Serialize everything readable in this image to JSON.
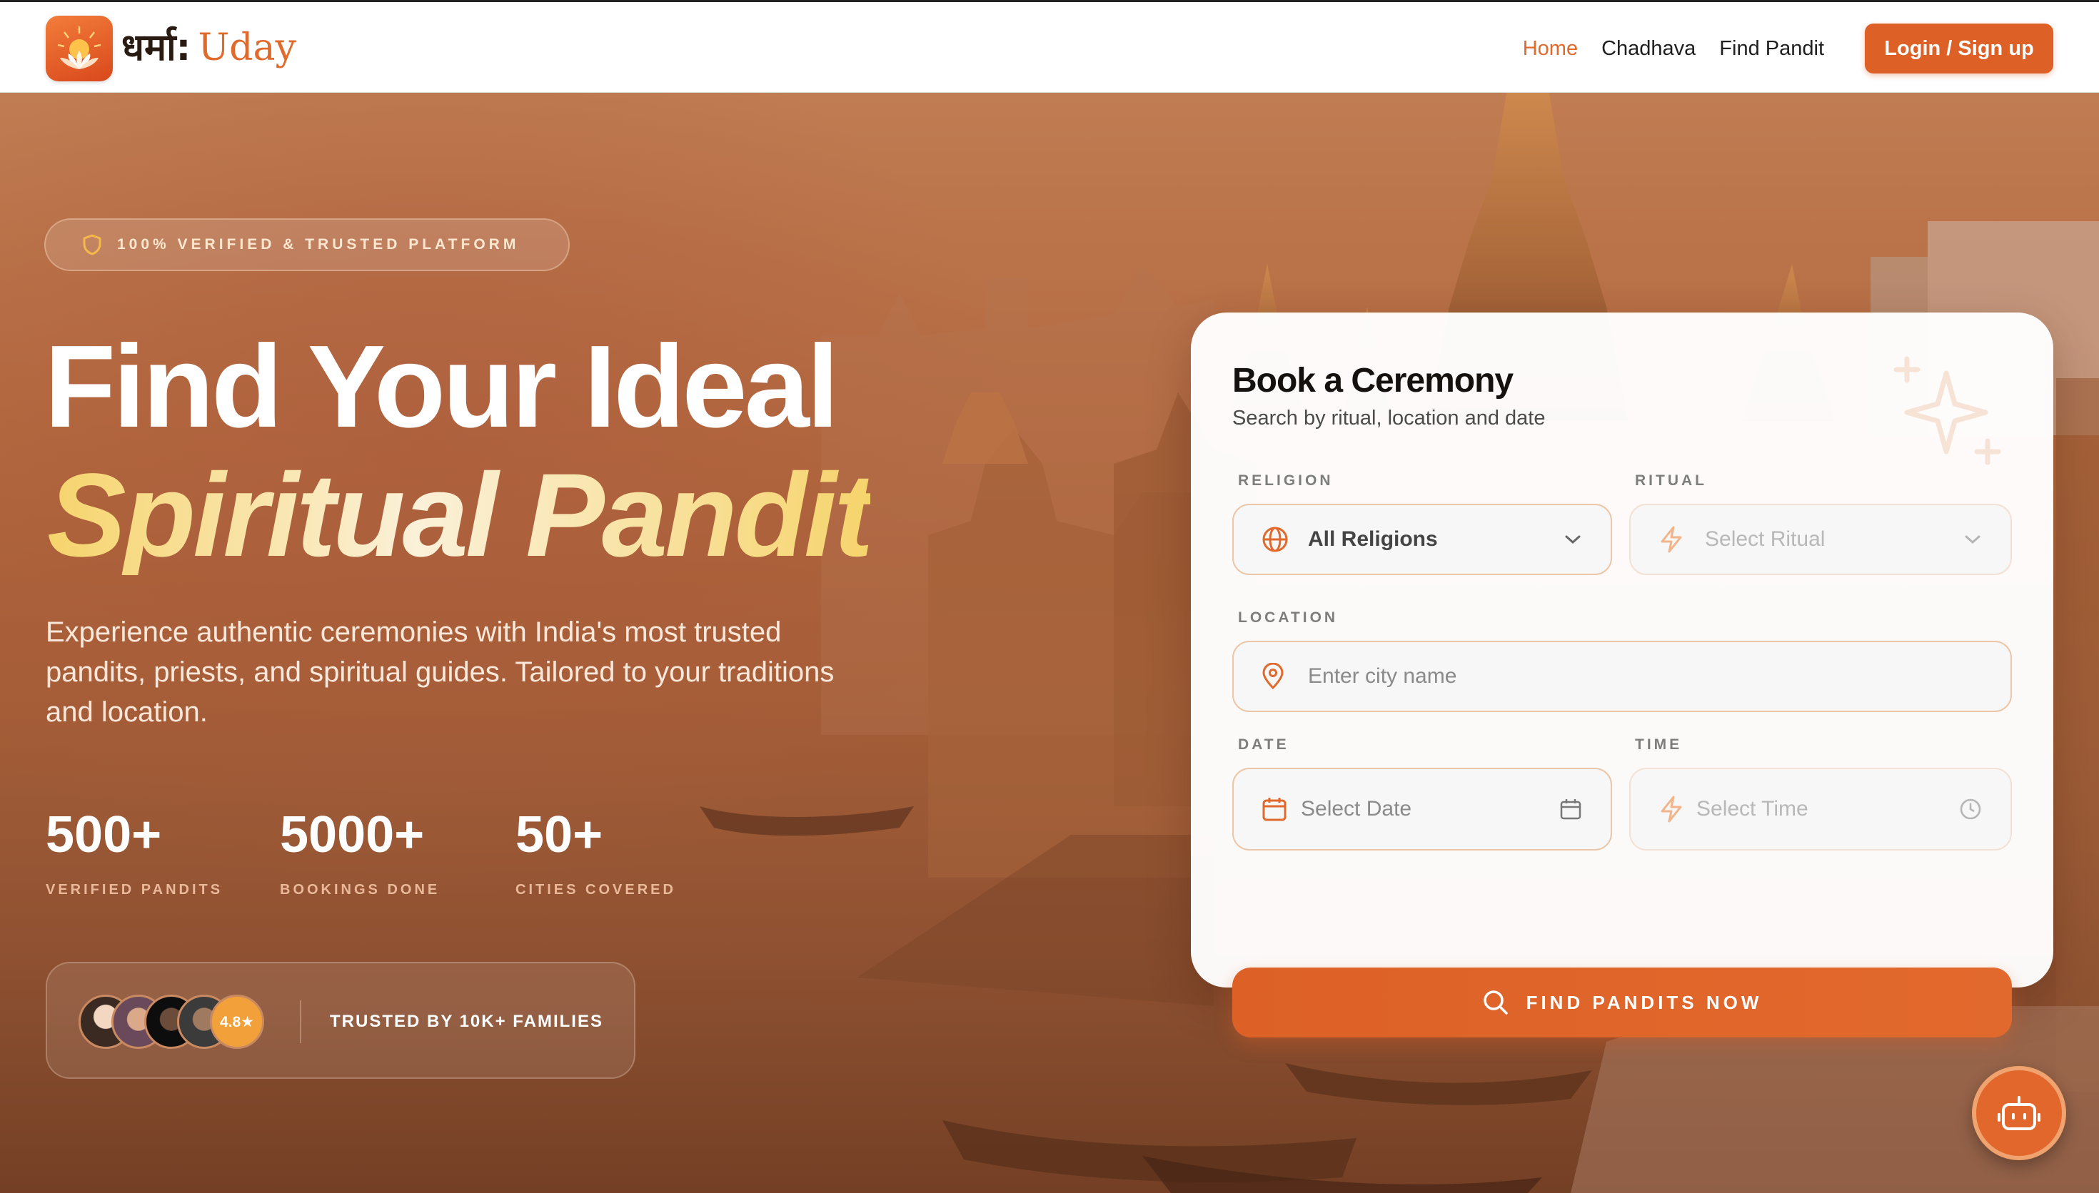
{
  "header": {
    "logo_devanagari": "धर्मा:",
    "logo_latin": "Uday",
    "nav": [
      {
        "label": "Home",
        "active": true
      },
      {
        "label": "Chadhava",
        "active": false
      },
      {
        "label": "Find Pandit",
        "active": false
      }
    ],
    "login_label": "Login / Sign up"
  },
  "hero": {
    "badge": "100% VERIFIED & TRUSTED PLATFORM",
    "title_line1": "Find Your Ideal",
    "title_line2": "Spiritual Pandit",
    "subtitle": "Experience authentic ceremonies with India's most trusted pandits, priests, and spiritual guides. Tailored to your traditions and location.",
    "stats": [
      {
        "value": "500+",
        "label": "VERIFIED PANDITS"
      },
      {
        "value": "5000+",
        "label": "BOOKINGS DONE"
      },
      {
        "value": "50+",
        "label": "CITIES COVERED"
      }
    ],
    "trust": {
      "rating": "4.8★",
      "text": "TRUSTED BY 10K+ FAMILIES"
    }
  },
  "booking": {
    "title": "Book a Ceremony",
    "subtitle": "Search by ritual, location and date",
    "religion": {
      "label": "RELIGION",
      "value": "All Religions"
    },
    "ritual": {
      "label": "RITUAL",
      "placeholder": "Select Ritual"
    },
    "location": {
      "label": "LOCATION",
      "placeholder": "Enter city name"
    },
    "date": {
      "label": "DATE",
      "placeholder": "Select Date"
    },
    "time": {
      "label": "TIME",
      "placeholder": "Select Time"
    },
    "submit_label": "FIND PANDITS NOW"
  },
  "colors": {
    "accent": "#dd6127",
    "gold": "#f6d46c"
  }
}
